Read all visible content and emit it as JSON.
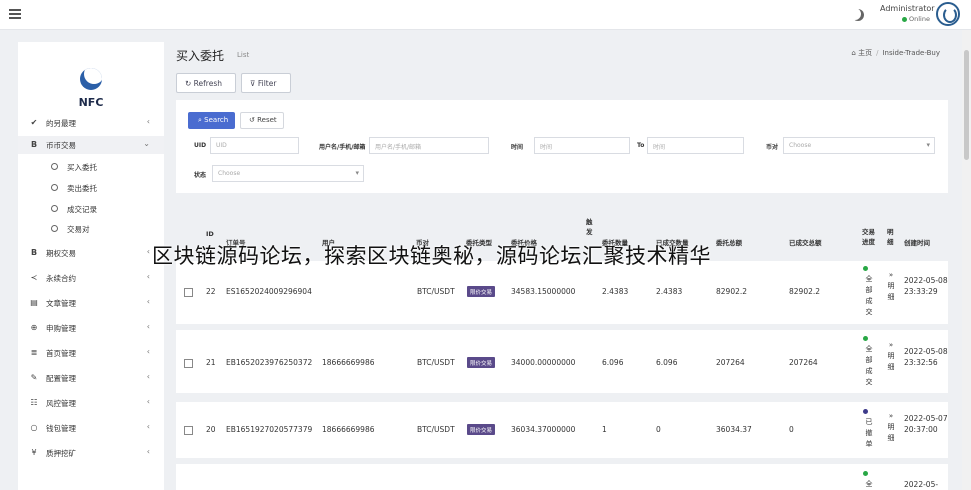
{
  "topbar": {
    "admin_name": "Administrator",
    "online_label": "Online"
  },
  "sidebar": {
    "logo": "NFC",
    "items": [
      {
        "icon": "✔",
        "label": "的另最理",
        "arrow": "‹"
      },
      {
        "icon": "B",
        "label": "币币交易",
        "arrow": "⌄"
      },
      {
        "icon": "B",
        "label": "期权交易",
        "arrow": "‹"
      },
      {
        "icon": "≺",
        "label": "永续合约",
        "arrow": "‹"
      },
      {
        "icon": "▤",
        "label": "文章管理",
        "arrow": "‹"
      },
      {
        "icon": "⊕",
        "label": "申购管理",
        "arrow": "‹"
      },
      {
        "icon": "≣",
        "label": "首页管理",
        "arrow": "‹"
      },
      {
        "icon": "✎",
        "label": "配置管理",
        "arrow": "‹"
      },
      {
        "icon": "☷",
        "label": "风控管理",
        "arrow": "‹"
      },
      {
        "icon": "○",
        "label": "钱包管理",
        "arrow": "‹"
      },
      {
        "icon": "¥",
        "label": "质押挖矿",
        "arrow": "‹"
      }
    ],
    "subitems": [
      "买入委托",
      "卖出委托",
      "成交记录",
      "交易对"
    ]
  },
  "page": {
    "title": "买入委托",
    "subtitle": "List",
    "breadcrumb_home": "主页",
    "breadcrumb_sep": "/",
    "breadcrumb_current": "Inside-Trade-Buy"
  },
  "toolbar": {
    "refresh": "Refresh",
    "filter": "Filter"
  },
  "filters": {
    "search": "Search",
    "reset": "Reset",
    "uid_label": "UID",
    "uid_placeholder": "UID",
    "user_label": "用户名/手机/邮箱",
    "user_placeholder": "用户名/手机/邮箱",
    "time_label": "时间",
    "time_from_placeholder": "时间",
    "time_to_label": "To",
    "time_to_placeholder": "时间",
    "pair_label": "币对",
    "pair_placeholder": "Choose",
    "status_label": "状态",
    "status_placeholder": "Choose"
  },
  "table": {
    "headers": {
      "id": "ID",
      "order_no": "订单号",
      "user": "用户",
      "pair": "币对",
      "type": "委托类型",
      "price": "委托价格",
      "count_top": "触发",
      "amount": "委托数量",
      "traded": "已成交数量",
      "total": "委托总额",
      "traded_total": "已成交总额",
      "progress": "交易进度",
      "detail": "明细",
      "created": "创建时间"
    },
    "rows": [
      {
        "id": "22",
        "order_no": "ES1652024009296904",
        "user": "",
        "pair": "BTC/USDT",
        "type": "限价交易",
        "price": "34583.15000000",
        "amount": "2.4383",
        "traded": "2.4383",
        "total": "82902.2",
        "traded_total": "82902.2",
        "status": "全部成交",
        "status_color": "#28a745",
        "detail_mark": "»",
        "detail": "明细",
        "date": "2022-05-08",
        "time": "23:33:29"
      },
      {
        "id": "21",
        "order_no": "EB1652023976250372",
        "user": "18666669986",
        "pair": "BTC/USDT",
        "type": "限价交易",
        "price": "34000.00000000",
        "amount": "6.096",
        "traded": "6.096",
        "total": "207264",
        "traded_total": "207264",
        "status": "全部成交",
        "status_color": "#28a745",
        "detail_mark": "»",
        "detail": "明细",
        "date": "2022-05-08",
        "time": "23:32:56"
      },
      {
        "id": "20",
        "order_no": "EB1651927020577379",
        "user": "18666669986",
        "pair": "BTC/USDT",
        "type": "限价交易",
        "price": "36034.37000000",
        "amount": "1",
        "traded": "0",
        "total": "36034.37",
        "traded_total": "0",
        "status": "已撤单",
        "status_color": "#3d3a8a",
        "detail_mark": "»",
        "detail": "明细",
        "date": "2022-05-07",
        "time": "20:37:00"
      },
      {
        "id": "",
        "order_no": "",
        "user": "",
        "pair": "",
        "type": "",
        "price": "",
        "amount": "",
        "traded": "",
        "total": "",
        "traded_total": "",
        "status": "全",
        "status_color": "#28a745",
        "detail_mark": "",
        "detail": "",
        "date": "2022-05-",
        "time": ""
      }
    ]
  },
  "overlay": {
    "watermark": "区块链源码论坛，探索区块链奥秘，源码论坛汇聚技术精华"
  }
}
